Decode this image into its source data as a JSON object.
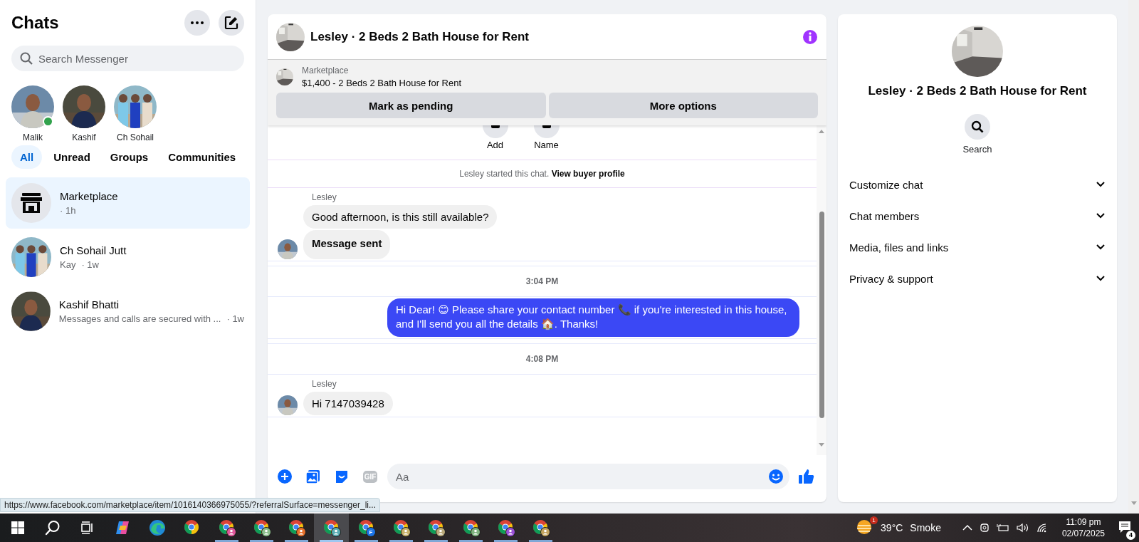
{
  "sidebar": {
    "title": "Chats",
    "search": {
      "placeholder": "Search Messenger"
    },
    "stories": [
      {
        "name": "Malik",
        "online": true
      },
      {
        "name": "Kashif",
        "online": false
      },
      {
        "name": "Ch Sohail",
        "online": false
      }
    ],
    "filters": [
      {
        "label": "All",
        "selected": true
      },
      {
        "label": "Unread",
        "selected": false
      },
      {
        "label": "Groups",
        "selected": false
      },
      {
        "label": "Communities",
        "selected": false
      }
    ],
    "chats": [
      {
        "kind": "marketplace",
        "name": "Marketplace",
        "time": "· 1h",
        "selected": true
      },
      {
        "kind": "person",
        "name": "Ch Sohail Jutt",
        "preview": "Kay",
        "time": "· 1w",
        "selected": false
      },
      {
        "kind": "person",
        "name": "Kashif Bhatti",
        "preview": "Messages and calls are secured with ...",
        "time": "· 1w",
        "selected": false
      }
    ]
  },
  "chat": {
    "title": "Lesley · 2 Beds 2 Bath House for Rent",
    "listing": {
      "source": "Marketplace",
      "title": "$1,400 - 2 Beds 2 Bath House for Rent"
    },
    "actions": [
      "Mark as pending",
      "More options"
    ],
    "quick_actions": [
      "Add",
      "Name"
    ],
    "messages": [
      {
        "kind": "system",
        "text": "Lesley started this chat.",
        "link": "View buyer profile"
      },
      {
        "kind": "incoming",
        "sender": "Lesley",
        "bubbles": [
          {
            "text": "Good afternoon, is this still available?",
            "bold": false
          },
          {
            "text": "Message sent",
            "bold": true
          }
        ]
      },
      {
        "kind": "timestamp",
        "text": "3:04 PM"
      },
      {
        "kind": "outgoing",
        "text": "Hi Dear! 😊 Please share your contact number 📞 if you're interested in this house, and I'll send you all the details 🏠. Thanks!"
      },
      {
        "kind": "timestamp",
        "text": "4:08 PM"
      },
      {
        "kind": "incoming",
        "sender": "Lesley",
        "bubbles": [
          {
            "text": "Hi 7147039428",
            "bold": false
          }
        ]
      }
    ],
    "composer": {
      "placeholder": "Aa",
      "gif": "GIF"
    }
  },
  "details": {
    "title": "Lesley · 2 Beds 2 Bath House for Rent",
    "actions": [
      "Search"
    ],
    "sections": [
      {
        "label": "Customize chat",
        "expanded": false
      },
      {
        "label": "Chat members",
        "expanded": false
      },
      {
        "label": "Media, files and links",
        "expanded": false
      },
      {
        "label": "Privacy & support",
        "expanded": false
      }
    ]
  },
  "status_url": "https://www.facebook.com/marketplace/item/1016140366975055/?referralSurface=messenger_li...",
  "taskbar": {
    "apps": [
      {
        "kind": "start",
        "selected": false,
        "running": false
      },
      {
        "kind": "search",
        "selected": false,
        "running": false
      },
      {
        "kind": "task-view",
        "selected": false,
        "running": false
      },
      {
        "kind": "copilot",
        "selected": false,
        "running": false
      },
      {
        "kind": "edge",
        "selected": false,
        "running": false
      },
      {
        "kind": "chrome",
        "selected": false,
        "running": false
      },
      {
        "kind": "chrome-profile",
        "color": "#e0569a",
        "selected": false,
        "running": true
      },
      {
        "kind": "chrome-profile",
        "color": "#8cbf8c",
        "selected": false,
        "running": true
      },
      {
        "kind": "chrome-profile",
        "color": "#e8702a",
        "selected": false,
        "running": true
      },
      {
        "kind": "chrome-profile",
        "color": "#5aaeb4",
        "selected": true,
        "running": true
      },
      {
        "kind": "chrome-profile",
        "color": "#1a73e8",
        "badge": "F",
        "selected": false,
        "running": true
      },
      {
        "kind": "chrome-profile",
        "color": "#c9b26a",
        "selected": false,
        "running": true
      },
      {
        "kind": "chrome-profile",
        "color": "#b9a97a",
        "selected": false,
        "running": true
      },
      {
        "kind": "chrome-profile",
        "color": "#7fb37f",
        "selected": false,
        "running": true
      },
      {
        "kind": "chrome-profile",
        "color": "#9a4fd6",
        "selected": false,
        "running": true
      },
      {
        "kind": "chrome-profile",
        "color": "#c4a460",
        "selected": false,
        "running": true
      }
    ],
    "weather": {
      "badge": "1",
      "temperature": "39°C",
      "condition": "Smoke"
    },
    "clock": {
      "time": "11:09 pm",
      "date": "02/07/2025"
    },
    "notifications": "4"
  }
}
